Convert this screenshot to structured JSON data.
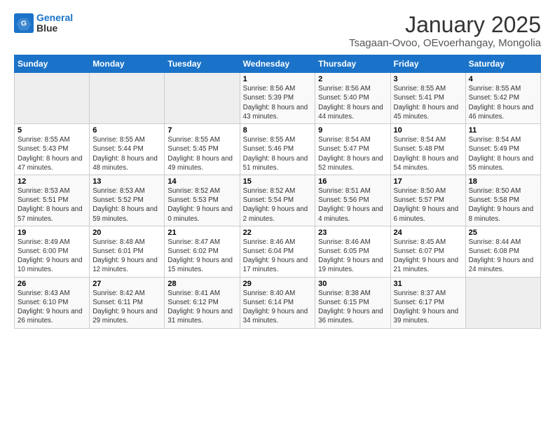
{
  "header": {
    "logo_line1": "General",
    "logo_line2": "Blue",
    "title": "January 2025",
    "subtitle": "Tsagaan-Ovoo, OEvoerhangay, Mongolia"
  },
  "weekdays": [
    "Sunday",
    "Monday",
    "Tuesday",
    "Wednesday",
    "Thursday",
    "Friday",
    "Saturday"
  ],
  "weeks": [
    [
      {
        "day": "",
        "sunrise": "",
        "sunset": "",
        "daylight": ""
      },
      {
        "day": "",
        "sunrise": "",
        "sunset": "",
        "daylight": ""
      },
      {
        "day": "",
        "sunrise": "",
        "sunset": "",
        "daylight": ""
      },
      {
        "day": "1",
        "sunrise": "Sunrise: 8:56 AM",
        "sunset": "Sunset: 5:39 PM",
        "daylight": "Daylight: 8 hours and 43 minutes."
      },
      {
        "day": "2",
        "sunrise": "Sunrise: 8:56 AM",
        "sunset": "Sunset: 5:40 PM",
        "daylight": "Daylight: 8 hours and 44 minutes."
      },
      {
        "day": "3",
        "sunrise": "Sunrise: 8:55 AM",
        "sunset": "Sunset: 5:41 PM",
        "daylight": "Daylight: 8 hours and 45 minutes."
      },
      {
        "day": "4",
        "sunrise": "Sunrise: 8:55 AM",
        "sunset": "Sunset: 5:42 PM",
        "daylight": "Daylight: 8 hours and 46 minutes."
      }
    ],
    [
      {
        "day": "5",
        "sunrise": "Sunrise: 8:55 AM",
        "sunset": "Sunset: 5:43 PM",
        "daylight": "Daylight: 8 hours and 47 minutes."
      },
      {
        "day": "6",
        "sunrise": "Sunrise: 8:55 AM",
        "sunset": "Sunset: 5:44 PM",
        "daylight": "Daylight: 8 hours and 48 minutes."
      },
      {
        "day": "7",
        "sunrise": "Sunrise: 8:55 AM",
        "sunset": "Sunset: 5:45 PM",
        "daylight": "Daylight: 8 hours and 49 minutes."
      },
      {
        "day": "8",
        "sunrise": "Sunrise: 8:55 AM",
        "sunset": "Sunset: 5:46 PM",
        "daylight": "Daylight: 8 hours and 51 minutes."
      },
      {
        "day": "9",
        "sunrise": "Sunrise: 8:54 AM",
        "sunset": "Sunset: 5:47 PM",
        "daylight": "Daylight: 8 hours and 52 minutes."
      },
      {
        "day": "10",
        "sunrise": "Sunrise: 8:54 AM",
        "sunset": "Sunset: 5:48 PM",
        "daylight": "Daylight: 8 hours and 54 minutes."
      },
      {
        "day": "11",
        "sunrise": "Sunrise: 8:54 AM",
        "sunset": "Sunset: 5:49 PM",
        "daylight": "Daylight: 8 hours and 55 minutes."
      }
    ],
    [
      {
        "day": "12",
        "sunrise": "Sunrise: 8:53 AM",
        "sunset": "Sunset: 5:51 PM",
        "daylight": "Daylight: 8 hours and 57 minutes."
      },
      {
        "day": "13",
        "sunrise": "Sunrise: 8:53 AM",
        "sunset": "Sunset: 5:52 PM",
        "daylight": "Daylight: 8 hours and 59 minutes."
      },
      {
        "day": "14",
        "sunrise": "Sunrise: 8:52 AM",
        "sunset": "Sunset: 5:53 PM",
        "daylight": "Daylight: 9 hours and 0 minutes."
      },
      {
        "day": "15",
        "sunrise": "Sunrise: 8:52 AM",
        "sunset": "Sunset: 5:54 PM",
        "daylight": "Daylight: 9 hours and 2 minutes."
      },
      {
        "day": "16",
        "sunrise": "Sunrise: 8:51 AM",
        "sunset": "Sunset: 5:56 PM",
        "daylight": "Daylight: 9 hours and 4 minutes."
      },
      {
        "day": "17",
        "sunrise": "Sunrise: 8:50 AM",
        "sunset": "Sunset: 5:57 PM",
        "daylight": "Daylight: 9 hours and 6 minutes."
      },
      {
        "day": "18",
        "sunrise": "Sunrise: 8:50 AM",
        "sunset": "Sunset: 5:58 PM",
        "daylight": "Daylight: 9 hours and 8 minutes."
      }
    ],
    [
      {
        "day": "19",
        "sunrise": "Sunrise: 8:49 AM",
        "sunset": "Sunset: 6:00 PM",
        "daylight": "Daylight: 9 hours and 10 minutes."
      },
      {
        "day": "20",
        "sunrise": "Sunrise: 8:48 AM",
        "sunset": "Sunset: 6:01 PM",
        "daylight": "Daylight: 9 hours and 12 minutes."
      },
      {
        "day": "21",
        "sunrise": "Sunrise: 8:47 AM",
        "sunset": "Sunset: 6:02 PM",
        "daylight": "Daylight: 9 hours and 15 minutes."
      },
      {
        "day": "22",
        "sunrise": "Sunrise: 8:46 AM",
        "sunset": "Sunset: 6:04 PM",
        "daylight": "Daylight: 9 hours and 17 minutes."
      },
      {
        "day": "23",
        "sunrise": "Sunrise: 8:46 AM",
        "sunset": "Sunset: 6:05 PM",
        "daylight": "Daylight: 9 hours and 19 minutes."
      },
      {
        "day": "24",
        "sunrise": "Sunrise: 8:45 AM",
        "sunset": "Sunset: 6:07 PM",
        "daylight": "Daylight: 9 hours and 21 minutes."
      },
      {
        "day": "25",
        "sunrise": "Sunrise: 8:44 AM",
        "sunset": "Sunset: 6:08 PM",
        "daylight": "Daylight: 9 hours and 24 minutes."
      }
    ],
    [
      {
        "day": "26",
        "sunrise": "Sunrise: 8:43 AM",
        "sunset": "Sunset: 6:10 PM",
        "daylight": "Daylight: 9 hours and 26 minutes."
      },
      {
        "day": "27",
        "sunrise": "Sunrise: 8:42 AM",
        "sunset": "Sunset: 6:11 PM",
        "daylight": "Daylight: 9 hours and 29 minutes."
      },
      {
        "day": "28",
        "sunrise": "Sunrise: 8:41 AM",
        "sunset": "Sunset: 6:12 PM",
        "daylight": "Daylight: 9 hours and 31 minutes."
      },
      {
        "day": "29",
        "sunrise": "Sunrise: 8:40 AM",
        "sunset": "Sunset: 6:14 PM",
        "daylight": "Daylight: 9 hours and 34 minutes."
      },
      {
        "day": "30",
        "sunrise": "Sunrise: 8:38 AM",
        "sunset": "Sunset: 6:15 PM",
        "daylight": "Daylight: 9 hours and 36 minutes."
      },
      {
        "day": "31",
        "sunrise": "Sunrise: 8:37 AM",
        "sunset": "Sunset: 6:17 PM",
        "daylight": "Daylight: 9 hours and 39 minutes."
      },
      {
        "day": "",
        "sunrise": "",
        "sunset": "",
        "daylight": ""
      }
    ]
  ]
}
